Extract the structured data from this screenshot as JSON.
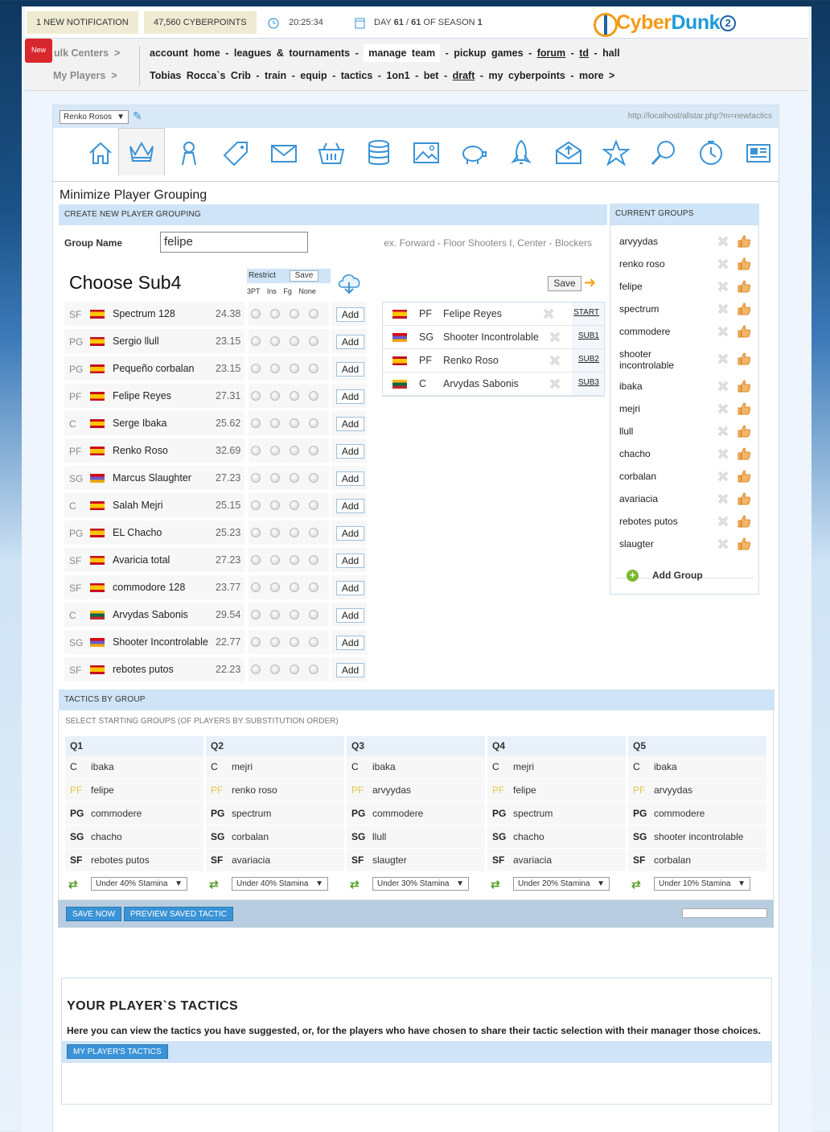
{
  "topbar": {
    "notification": "1 NEW NOTIFICATION",
    "cyberpoints": "47,560 CYBERPOINTS",
    "time": "20:25:34",
    "day_prefix": "DAY",
    "day_current": "61",
    "day_total": "61",
    "season_prefix": "OF SEASON",
    "season": "1",
    "new_badge": "New",
    "logo_part1": "Cyber",
    "logo_part2": "Dunk",
    "logo_num": "2"
  },
  "nav": {
    "row1_label": "ulk Centers",
    "row2_label": "My Players",
    "row1": [
      "account home",
      "leagues & tournaments",
      "manage team",
      "pickup games",
      "forum",
      "td",
      "hall"
    ],
    "row2": [
      "Tobias Rocca`s Crib",
      "train",
      "equip",
      "tactics",
      "1on1",
      "bet",
      "draft",
      "my cyberpoints",
      "more"
    ]
  },
  "panel": {
    "team_select": "Renko Rosos",
    "url": "http://localhost/allstar.php?m=newtactics",
    "title": "Minimize Player Grouping"
  },
  "create": {
    "header": "CREATE NEW PLAYER GROUPING",
    "group_name_label": "Group Name",
    "group_name_value": "felipe",
    "example": "ex. Forward - Floor Shooters I, Center - Blockers",
    "choose": "Choose Sub4",
    "restrict": "Restrict",
    "restrict_save": "Save",
    "restrict_labels": "3PT Ins Fg None",
    "save": "Save",
    "add_label": "Add"
  },
  "roster": [
    {
      "pos": "SF",
      "flag": "es",
      "name": "Spectrum 128",
      "val": "24.38"
    },
    {
      "pos": "PG",
      "flag": "es",
      "name": "Sergio llull",
      "val": "23.15"
    },
    {
      "pos": "PG",
      "flag": "es",
      "name": "Pequeño corbalan",
      "val": "23.15"
    },
    {
      "pos": "PF",
      "flag": "es",
      "name": "Felipe Reyes",
      "val": "27.31"
    },
    {
      "pos": "C",
      "flag": "es",
      "name": "Serge Ibaka",
      "val": "25.62"
    },
    {
      "pos": "PF",
      "flag": "es",
      "name": "Renko Roso",
      "val": "32.69"
    },
    {
      "pos": "SG",
      "flag": "am",
      "name": "Marcus Slaughter",
      "val": "27.23"
    },
    {
      "pos": "C",
      "flag": "es",
      "name": "Salah Mejri",
      "val": "25.15"
    },
    {
      "pos": "PG",
      "flag": "es",
      "name": "EL Chacho",
      "val": "25.23"
    },
    {
      "pos": "SF",
      "flag": "es",
      "name": "Avaricia total",
      "val": "27.23"
    },
    {
      "pos": "SF",
      "flag": "es",
      "name": "commodore 128",
      "val": "23.77"
    },
    {
      "pos": "C",
      "flag": "lt",
      "name": "Arvydas Sabonis",
      "val": "29.54"
    },
    {
      "pos": "SG",
      "flag": "am",
      "name": "Shooter Incontrolable",
      "val": "22.77"
    },
    {
      "pos": "SF",
      "flag": "es",
      "name": "rebotes putos",
      "val": "22.23"
    }
  ],
  "lineup": [
    {
      "flag": "es",
      "pos": "PF",
      "name": "Felipe Reyes",
      "slot": "START"
    },
    {
      "flag": "am",
      "pos": "SG",
      "name": "Shooter Incontrolable",
      "slot": "SUB1"
    },
    {
      "flag": "es",
      "pos": "PF",
      "name": "Renko Roso",
      "slot": "SUB2"
    },
    {
      "flag": "lt",
      "pos": "C",
      "name": "Arvydas Sabonis",
      "slot": "SUB3"
    }
  ],
  "groups": {
    "header": "CURRENT GROUPS",
    "items": [
      "arvyydas",
      "renko roso",
      "felipe",
      "spectrum",
      "commodere",
      "shooter incontrolable",
      "ibaka",
      "mejri",
      "llull",
      "chacho",
      "corbalan",
      "avariacia",
      "rebotes putos",
      "slaugter"
    ],
    "add": "Add Group"
  },
  "tactics": {
    "header": "TACTICS BY GROUP",
    "subheader": "SELECT STARTING GROUPS (OF PLAYERS BY SUBSTITUTION ORDER)",
    "quarters": [
      {
        "q": "Q1",
        "c": "ibaka",
        "pf": "felipe",
        "pg": "commodere",
        "sg": "chacho",
        "sf": "rebotes putos",
        "stamina": "Under 40% Stamina"
      },
      {
        "q": "Q2",
        "c": "mejri",
        "pf": "renko roso",
        "pg": "spectrum",
        "sg": "corbalan",
        "sf": "avariacia",
        "stamina": "Under 40% Stamina"
      },
      {
        "q": "Q3",
        "c": "ibaka",
        "pf": "arvyydas",
        "pg": "commodere",
        "sg": "llull",
        "sf": "slaugter",
        "stamina": "Under 30% Stamina"
      },
      {
        "q": "Q4",
        "c": "mejri",
        "pf": "felipe",
        "pg": "spectrum",
        "sg": "chacho",
        "sf": "avariacia",
        "stamina": "Under 20% Stamina"
      },
      {
        "q": "Q5",
        "c": "ibaka",
        "pf": "arvyydas",
        "pg": "commodere",
        "sg": "shooter incontrolable",
        "sf": "corbalan",
        "stamina": "Under 10% Stamina"
      }
    ],
    "pos_labels": {
      "c": "C",
      "pf": "PF",
      "pg": "PG",
      "sg": "SG",
      "sf": "SF"
    },
    "save_now": "SAVE NOW",
    "preview": "PREVIEW SAVED TACTIC"
  },
  "your_tactics": {
    "title": "YOUR PLAYER`S TACTICS",
    "desc": "Here you can view the tactics you have suggested, or, for the players who have chosen to share their tactic selection with their manager those choices.",
    "button": "MY PLAYER'S TACTICS"
  },
  "icons": [
    "home-icon",
    "crown-icon",
    "player-icon",
    "tag-icon",
    "mail-icon",
    "basket-icon",
    "database-icon",
    "image-icon",
    "piggy-bank-icon",
    "rocket-icon",
    "inbox-icon",
    "star-icon",
    "search-icon",
    "timer-icon",
    "newspaper-icon"
  ]
}
